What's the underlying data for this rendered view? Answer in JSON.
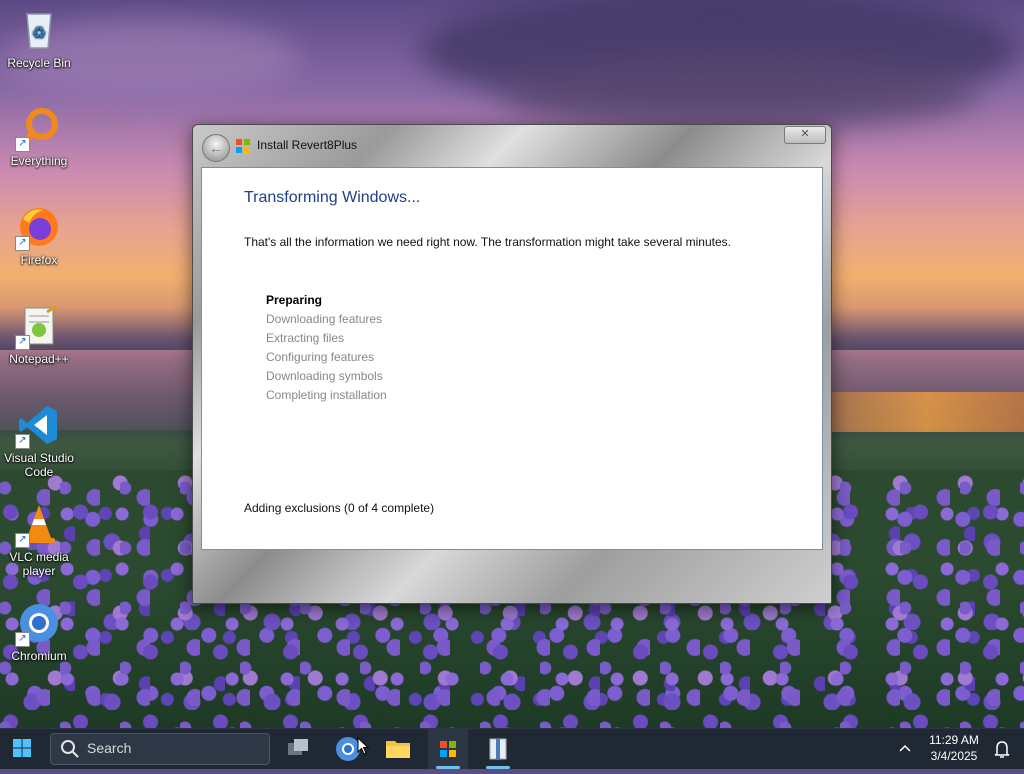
{
  "desktop": {
    "icons": [
      {
        "label": "Recycle Bin"
      },
      {
        "label": "Everything"
      },
      {
        "label": "Firefox"
      },
      {
        "label": "Notepad++"
      },
      {
        "label": "Visual Studio Code"
      },
      {
        "label": "VLC media player"
      },
      {
        "label": "Chromium"
      }
    ]
  },
  "window": {
    "title": "Install Revert8Plus",
    "close_label": "✕",
    "heading": "Transforming Windows...",
    "intro": "That's all the information we need right now. The transformation might take several minutes.",
    "steps": [
      {
        "label": "Preparing",
        "state": "active"
      },
      {
        "label": "Downloading features",
        "state": "pending"
      },
      {
        "label": "Extracting files",
        "state": "pending"
      },
      {
        "label": "Configuring features",
        "state": "pending"
      },
      {
        "label": "Downloading symbols",
        "state": "pending"
      },
      {
        "label": "Completing installation",
        "state": "pending"
      }
    ],
    "status": "Adding exclusions (0 of 4 complete)"
  },
  "taskbar": {
    "search_label": "Search",
    "time": "11:29 AM",
    "date": "3/4/2025"
  },
  "colors": {
    "heading": "#1e3f87",
    "taskbar": "#1f2833",
    "active_indicator": "#6cc4e8"
  }
}
